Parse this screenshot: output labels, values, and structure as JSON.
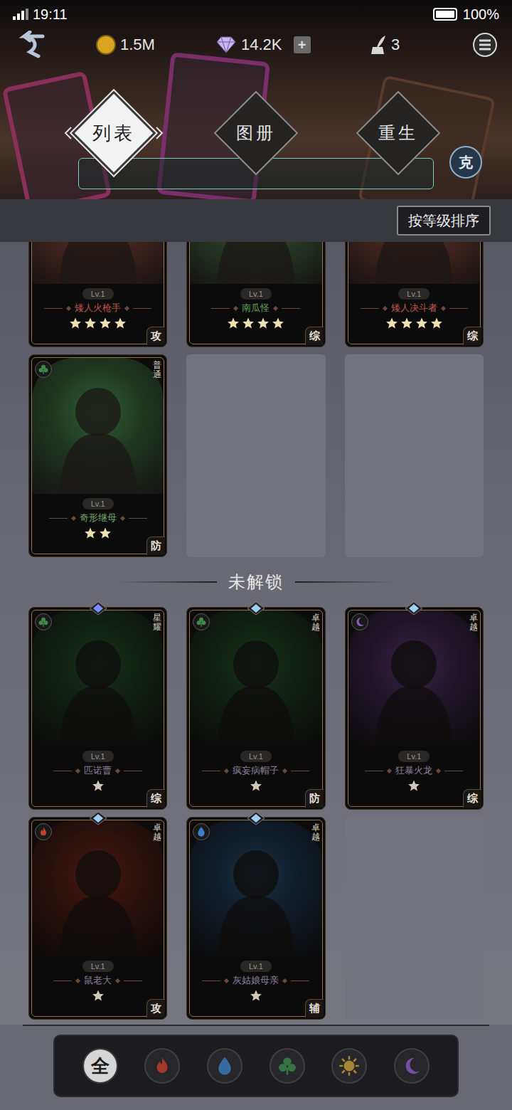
{
  "status_bar": {
    "time": "19:11",
    "battery": "100%",
    "battery_level": 1
  },
  "resources": {
    "gold": "1.5M",
    "gems": "14.2K",
    "gem_plus": "+",
    "quills": "3"
  },
  "tabs": [
    {
      "label": "列表",
      "selected": true
    },
    {
      "label": "图册",
      "selected": false
    },
    {
      "label": "重生",
      "selected": false
    }
  ],
  "counter_badge": "克",
  "sort_button": "按等级排序",
  "unlocked_cards": [
    {
      "name": "矮人火枪手",
      "level": "Lv.1",
      "stars": 4,
      "role": "攻",
      "color": "#c0584a"
    },
    {
      "name": "南瓜怪",
      "level": "Lv.1",
      "stars": 4,
      "role": "综",
      "color": "#5fa05f"
    },
    {
      "name": "矮人决斗者",
      "level": "Lv.1",
      "stars": 4,
      "role": "综",
      "color": "#c0584a"
    },
    {
      "name": "奇形继母",
      "level": "Lv.1",
      "stars": 2,
      "role": "防",
      "rarity": "普通",
      "element": "leaf",
      "color": "#6aa86a"
    }
  ],
  "locked_section": {
    "title": "未解锁"
  },
  "locked_cards": [
    {
      "name": "匹诺曹",
      "level": "Lv.1",
      "stars": 1,
      "role": "综",
      "rarity": "星耀",
      "element": "leaf",
      "color": "#8a7f99",
      "gem_color": "#7a8cff"
    },
    {
      "name": "疯妄病帽子",
      "level": "Lv.1",
      "stars": 1,
      "role": "防",
      "rarity": "卓越",
      "element": "leaf",
      "color": "#8a7f99",
      "gem_color": "#9fd0f0"
    },
    {
      "name": "狂暴火龙",
      "level": "Lv.1",
      "stars": 1,
      "role": "综",
      "rarity": "卓越",
      "element": "moon",
      "color": "#8a7f99",
      "gem_color": "#9fd0f0"
    },
    {
      "name": "鼠老大",
      "level": "Lv.1",
      "stars": 1,
      "role": "攻",
      "rarity": "卓越",
      "element": "fire",
      "color": "#8a7f99",
      "gem_color": "#9fd0f0"
    },
    {
      "name": "灰姑娘母亲",
      "level": "Lv.1",
      "stars": 1,
      "role": "辅",
      "rarity": "卓越",
      "element": "water",
      "color": "#8a7f99",
      "gem_color": "#9fd0f0"
    }
  ],
  "filters": [
    {
      "kind": "all",
      "label": "全",
      "selected": true
    },
    {
      "kind": "fire",
      "selected": false
    },
    {
      "kind": "water",
      "selected": false
    },
    {
      "kind": "leaf",
      "selected": false
    },
    {
      "kind": "sun",
      "selected": false
    },
    {
      "kind": "moon",
      "selected": false
    }
  ]
}
